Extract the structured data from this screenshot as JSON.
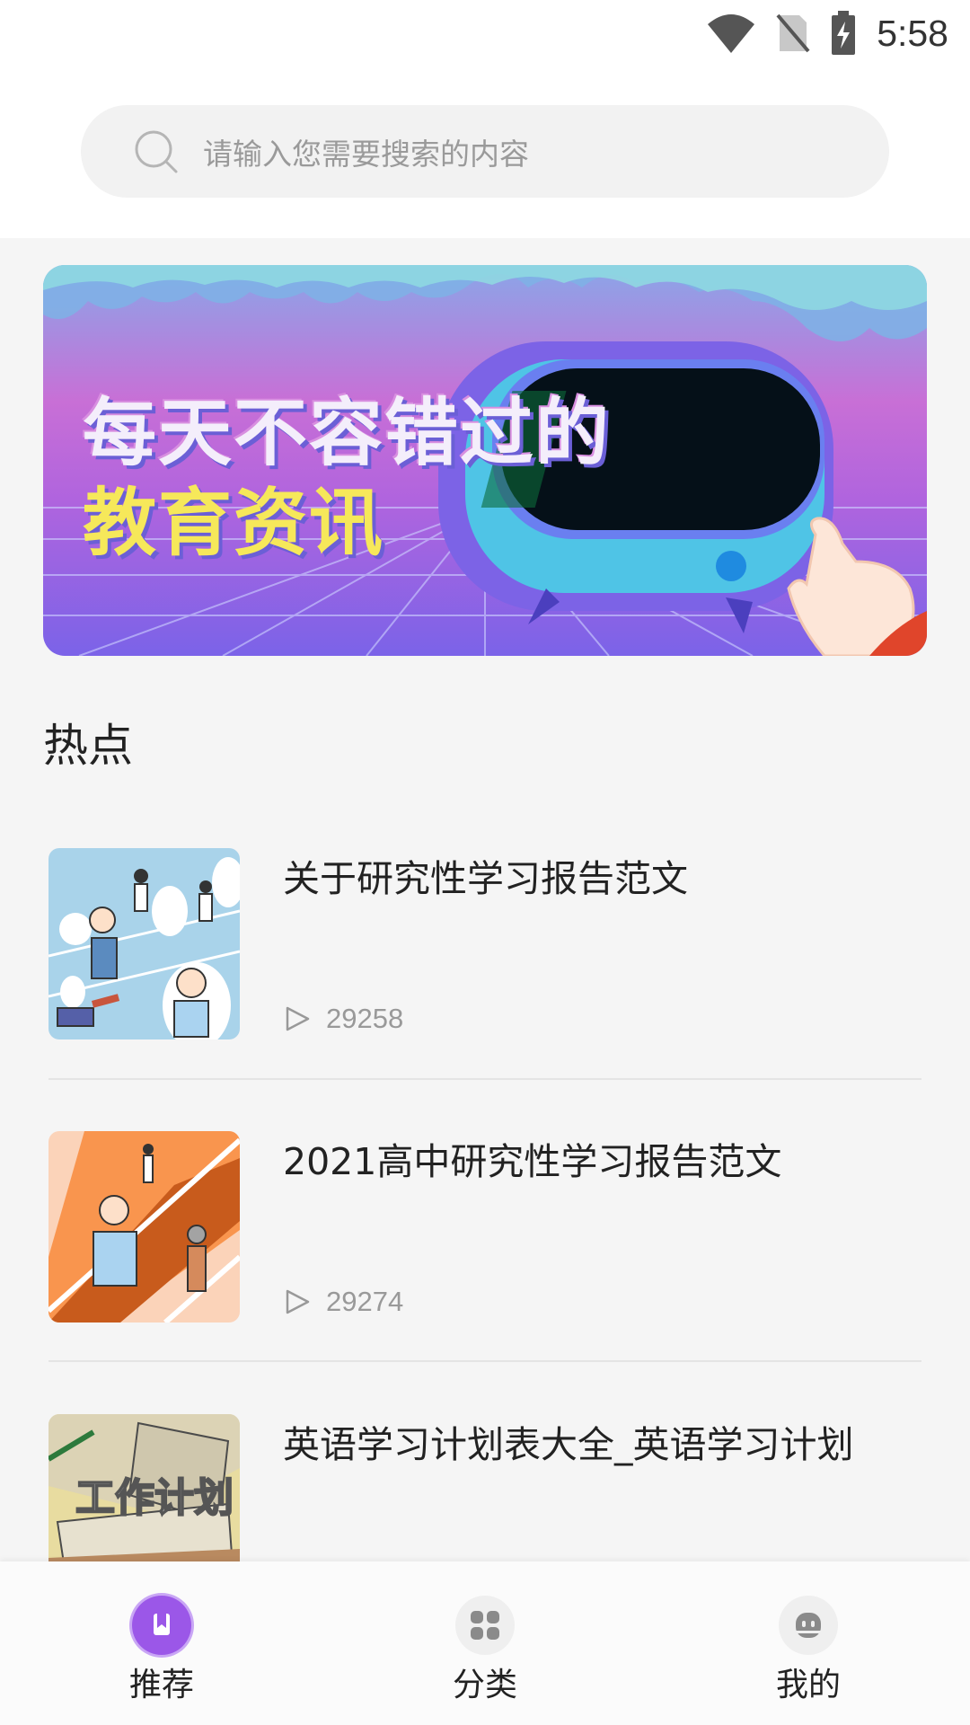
{
  "status_bar": {
    "time": "5:58",
    "icons": [
      "wifi-icon",
      "no-sim-icon",
      "battery-charging-icon"
    ]
  },
  "search": {
    "placeholder": "请输入您需要搜索的内容",
    "icon": "search-icon"
  },
  "banner": {
    "line1": "每天不容错过的",
    "line2": "教育资讯"
  },
  "section": {
    "title": "热点"
  },
  "articles": [
    {
      "title": "关于研究性学习报告范文",
      "views": "29258",
      "thumb_colors": [
        "#a9d3ea",
        "#ffffff"
      ]
    },
    {
      "title": "2021高中研究性学习报告范文",
      "views": "29274",
      "thumb_colors": [
        "#f9a05a",
        "#c85b1c"
      ]
    },
    {
      "title": "英语学习计划表大全_英语学习计划",
      "views": "",
      "thumb_colors": [
        "#e8dca0",
        "#c9c3b2"
      ]
    }
  ],
  "bottom_nav": {
    "items": [
      {
        "label": "推荐",
        "icon": "recommend-icon",
        "active": true
      },
      {
        "label": "分类",
        "icon": "category-icon",
        "active": false
      },
      {
        "label": "我的",
        "icon": "profile-icon",
        "active": false
      }
    ],
    "active_color": "#9b57e8",
    "inactive_bg": "#efefef"
  }
}
